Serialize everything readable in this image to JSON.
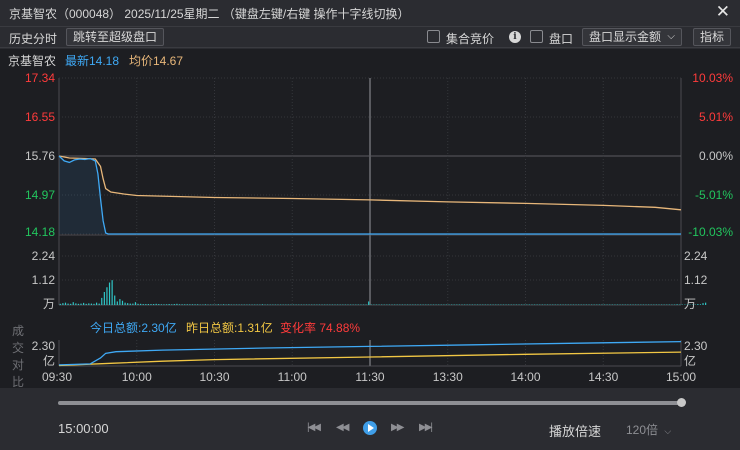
{
  "window": {
    "title": "京基智农（000048）  2025/11/25星期二  （键盘左键/右键 操作十字线切换）",
    "close_icon": "close-icon"
  },
  "toolbar": {
    "history_label": "历史分时",
    "jump_button": "跳转至超级盘口",
    "auction_label": "集合竞价",
    "orderbook_label": "盘口",
    "display_select": "盘口显示金额",
    "indicator_button": "指标"
  },
  "legend": {
    "stock_name": "京基智农",
    "latest": "最新14.18",
    "avg": "均价14.67"
  },
  "volume_header": {
    "compare_label": "成交对比",
    "today": "今日总额:2.30亿",
    "yesterday": "昨日总额:1.31亿",
    "change": "变化率 74.88%"
  },
  "colors": {
    "up": "#ff3b3b",
    "down": "#22c55e",
    "price": "#3fa9f5",
    "avg": "#e8b77a",
    "yesterday": "#f2c744",
    "today_amount": "#3fa9f5",
    "volume": "#2fc7c7"
  },
  "chart_data": {
    "type": "line",
    "price_axis": {
      "left_ticks": [
        "17.34",
        "16.55",
        "15.76",
        "14.97",
        "14.18"
      ],
      "right_ticks": [
        "10.03%",
        "5.01%",
        "0.00%",
        "-5.01%",
        "-10.03%"
      ],
      "ylim": [
        14.18,
        17.34
      ],
      "prev_close": 15.76
    },
    "volume_axis": {
      "ticks": [
        "2.24",
        "1.12",
        "万"
      ]
    },
    "amount_axis": {
      "ticks": [
        "2.30",
        "亿"
      ]
    },
    "x_labels": [
      "09:30",
      "10:00",
      "10:30",
      "11:00",
      "11:30",
      "13:30",
      "14:00",
      "14:30",
      "15:00"
    ],
    "total_minutes": 240,
    "series": [
      {
        "name": "最新",
        "minute": [
          0,
          2,
          4,
          6,
          8,
          10,
          12,
          14,
          15,
          16,
          17,
          18,
          19,
          240
        ],
        "values": [
          15.76,
          15.66,
          15.63,
          15.68,
          15.7,
          15.69,
          15.71,
          15.66,
          15.4,
          14.9,
          14.45,
          14.2,
          14.18,
          14.18
        ]
      },
      {
        "name": "均价",
        "minute": [
          0,
          4,
          10,
          14,
          16,
          17,
          18,
          20,
          25,
          30,
          45,
          60,
          90,
          120,
          150,
          180,
          210,
          230,
          240
        ],
        "values": [
          15.76,
          15.72,
          15.71,
          15.7,
          15.55,
          15.3,
          15.1,
          15.03,
          14.99,
          14.96,
          14.94,
          14.92,
          14.9,
          14.87,
          14.83,
          14.8,
          14.76,
          14.72,
          14.67
        ]
      }
    ],
    "volume_bars": {
      "max": 2.24,
      "heights_by_minute": [
        0.05,
        0.08,
        0.1,
        0.06,
        0.05,
        0.12,
        0.07,
        0.05,
        0.06,
        0.09,
        0.05,
        0.07,
        0.06,
        0.05,
        0.1,
        0.06,
        0.3,
        0.55,
        0.75,
        0.95,
        1.05,
        0.4,
        0.15,
        0.25,
        0.18,
        0.1,
        0.08,
        0.06,
        0.06,
        0.12,
        0.05,
        0.05,
        0.04,
        0.04,
        0.04,
        0.04,
        0.04,
        0.05,
        0.04,
        0.03,
        0.03,
        0.03,
        0.04,
        0.03,
        0.04,
        0.05,
        0.03,
        0.03,
        0.03,
        0.03,
        0.03,
        0.03,
        0.03,
        0.03,
        0.02,
        0.02,
        0.03,
        0.02,
        0.02,
        0.02,
        0.02,
        0.03,
        0.02,
        0.03,
        0.02,
        0.03,
        0.02,
        0.02,
        0.02,
        0.02,
        0.02,
        0.02,
        0.02,
        0.02,
        0.02,
        0.02,
        0.02,
        0.02,
        0.03,
        0.02,
        0.02,
        0.02,
        0.02,
        0.02,
        0.02,
        0.02,
        0.02,
        0.02,
        0.02,
        0.02,
        0.02,
        0.02,
        0.02,
        0.02,
        0.02,
        0.02,
        0.02,
        0.02,
        0.02,
        0.02,
        0.02,
        0.02,
        0.02,
        0.02,
        0.02,
        0.02,
        0.02,
        0.02,
        0.02,
        0.02,
        0.02,
        0.02,
        0.02,
        0.02,
        0.02,
        0.02,
        0.02,
        0.02,
        0.02,
        0.15,
        0.02,
        0.02,
        0.02,
        0.02,
        0.02,
        0.02,
        0.02,
        0.02,
        0.02,
        0.02,
        0.02,
        0.02,
        0.02,
        0.02,
        0.02,
        0.02,
        0.02,
        0.02,
        0.02,
        0.02,
        0.02,
        0.02,
        0.02,
        0.02,
        0.02,
        0.02,
        0.02,
        0.02,
        0.02,
        0.02,
        0.02,
        0.02,
        0.02,
        0.02,
        0.02,
        0.02,
        0.02,
        0.02,
        0.02,
        0.02,
        0.02,
        0.02,
        0.02,
        0.02,
        0.02,
        0.02,
        0.02,
        0.02,
        0.02,
        0.02,
        0.02,
        0.02,
        0.02,
        0.02,
        0.02,
        0.02,
        0.02,
        0.02,
        0.02,
        0.02,
        0.02,
        0.02,
        0.02,
        0.02,
        0.02,
        0.02,
        0.02,
        0.02,
        0.02,
        0.02,
        0.02,
        0.02,
        0.02,
        0.02,
        0.02,
        0.02,
        0.02,
        0.02,
        0.02,
        0.02,
        0.02,
        0.02,
        0.02,
        0.02,
        0.02,
        0.02,
        0.02,
        0.02,
        0.02,
        0.02,
        0.02,
        0.02,
        0.02,
        0.02,
        0.02,
        0.02,
        0.02,
        0.02,
        0.02,
        0.02,
        0.02,
        0.02,
        0.02,
        0.02,
        0.02,
        0.02,
        0.02,
        0.02,
        0.02,
        0.02,
        0.02,
        0.02,
        0.02,
        0.02,
        0.02,
        0.02,
        0.02,
        0.02,
        0.03,
        0.02,
        0.02,
        0.02,
        0.02,
        0.02,
        0.02,
        0.02,
        0.04,
        0.03,
        0.08,
        0.1
      ]
    },
    "amount_lines": [
      {
        "name": "今日总额",
        "minute": [
          0,
          12,
          16,
          18,
          22,
          40,
          80,
          120,
          160,
          200,
          240
        ],
        "values": [
          0.1,
          0.2,
          0.75,
          1.2,
          1.35,
          1.5,
          1.7,
          1.85,
          2.0,
          2.15,
          2.3
        ]
      },
      {
        "name": "昨日总额",
        "minute": [
          0,
          20,
          40,
          60,
          120,
          180,
          240
        ],
        "values": [
          0.05,
          0.25,
          0.45,
          0.6,
          0.85,
          1.1,
          1.31
        ]
      }
    ]
  },
  "playback": {
    "time": "15:00:00",
    "first_icon": "skip-first-icon",
    "prev_icon": "step-back-icon",
    "play_icon": "play-icon",
    "next_icon": "step-forward-icon",
    "last_icon": "skip-last-icon",
    "speed_label": "播放倍速",
    "speed_value": "120倍",
    "progress": 1.0
  }
}
